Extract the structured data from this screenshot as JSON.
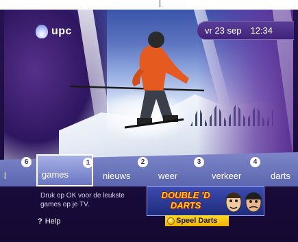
{
  "brand": {
    "logo_text": "upc",
    "logo_icon": "upc-flame-icon"
  },
  "clock": {
    "date": "vr 23 sep",
    "time": "12:34"
  },
  "menu": {
    "items": [
      {
        "label": "l",
        "number": "6"
      },
      {
        "label": "games",
        "number": "1",
        "selected": true
      },
      {
        "label": "nieuws",
        "number": "2"
      },
      {
        "label": "weer",
        "number": "3"
      },
      {
        "label": "verkeer",
        "number": "4"
      },
      {
        "label": "darts",
        "number": ""
      }
    ]
  },
  "info": {
    "description": "Druk op OK voor de leukste games op je TV."
  },
  "promo": {
    "title_line1": "DOUBLE 'D",
    "title_line2": "DARTS",
    "action_label": "Speel Darts",
    "action_icon": "yellow-button-icon"
  },
  "help": {
    "icon": "?",
    "label": "Help"
  },
  "colors": {
    "accent": "#ffd21a",
    "background": "#1c0c40",
    "selected_border": "#ffffff"
  }
}
